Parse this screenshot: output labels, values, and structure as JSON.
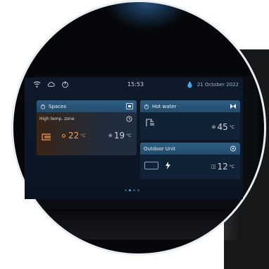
{
  "status_bar": {
    "time": "15:53",
    "date": "21 October 2022",
    "icons": [
      "wifi-icon",
      "cloud-icon",
      "power-icon",
      "water-drop-icon"
    ]
  },
  "spaces": {
    "title": "Spaces",
    "zone_label": "High temp. zone",
    "main_temp": "22",
    "side_temp": "19",
    "unit_symbol": "°C"
  },
  "hot_water": {
    "title": "Hot water",
    "temp": "45"
  },
  "outdoor_unit": {
    "title": "Outdoor Unit",
    "temp": "12"
  },
  "pager": {
    "pages": 4,
    "active": 2
  },
  "colors": {
    "card_header": "#2e5f86",
    "accent_orange": "#f3a15a",
    "accent_blue": "#4aa3e8"
  }
}
